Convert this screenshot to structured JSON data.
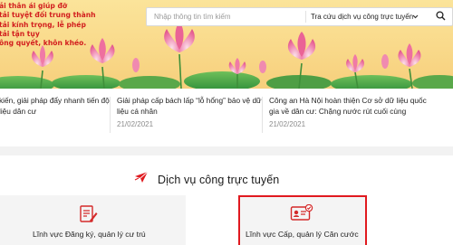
{
  "banner": {
    "motto_lines": [
      "ải thân ái giúp đỡ",
      "tải tuyệt đối trung thành",
      "tải kính trọng, lễ phép",
      "tải tận tụy",
      "ông quyết, khôn khéo."
    ]
  },
  "search": {
    "placeholder": "Nhập thông tin tìm kiếm",
    "selected": "Tra cứu dịch vụ công trực tuyến",
    "chevron": "chevron-down-icon",
    "button_icon": "search-icon"
  },
  "news": [
    {
      "title_lines": [
        "kiến, giải pháp đẩy nhanh tiến độ",
        "liệu dân cư"
      ],
      "date": ""
    },
    {
      "title_lines": [
        "Giải pháp cấp bách lấp “lỗ hổng” bảo vệ dữ",
        "liệu cá nhân"
      ],
      "date": "21/02/2021"
    },
    {
      "title_lines": [
        "Công an Hà Nội hoàn thiện Cơ sở dữ liệu quốc",
        "gia về dân cư: Chặng nước rút cuối cùng"
      ],
      "date": "21/02/2021"
    }
  ],
  "services": {
    "heading": "Dịch vụ công trực tuyến",
    "cards": [
      {
        "label": "Lĩnh vực Đăng ký, quản lý cư trú",
        "icon": "document-pen-icon",
        "highlighted": false
      },
      {
        "label": "Lĩnh vực Cấp, quản lý Căn cước",
        "icon": "id-card-icon",
        "highlighted": true
      }
    ]
  },
  "colors": {
    "accent_red": "#e0191f",
    "motto_red": "#d21e1e",
    "banner_gold": "#f9d98a"
  }
}
